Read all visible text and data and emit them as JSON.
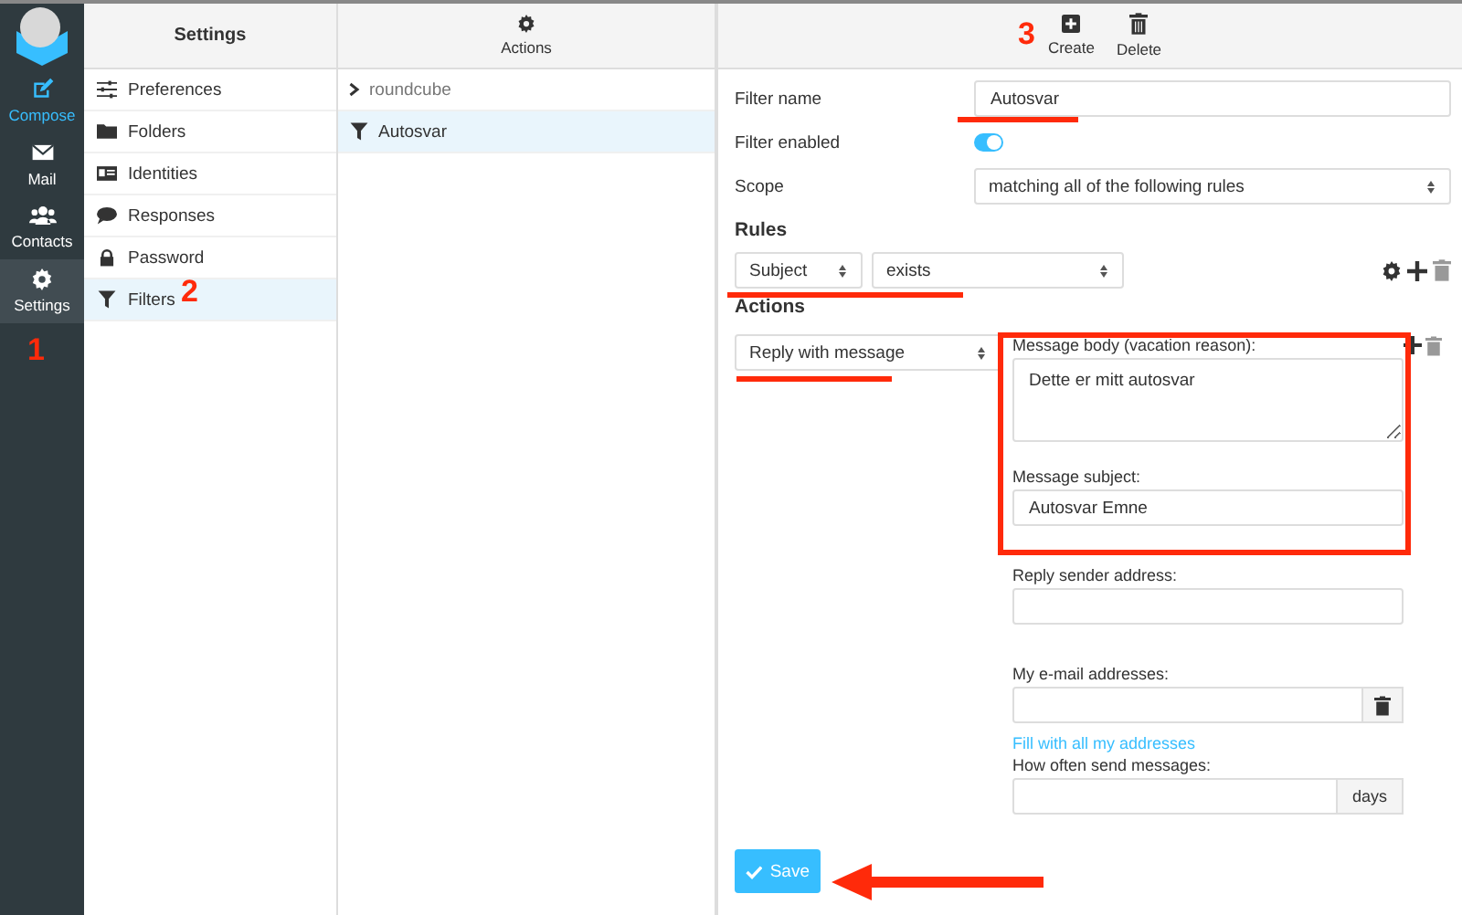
{
  "rail": [
    {
      "label": "Compose",
      "kind": "primary",
      "selected": false
    },
    {
      "label": "Mail",
      "kind": "nav",
      "selected": false
    },
    {
      "label": "Contacts",
      "kind": "nav",
      "selected": false
    },
    {
      "label": "Settings",
      "kind": "nav",
      "selected": true
    }
  ],
  "settings_panel": {
    "title": "Settings",
    "items": [
      {
        "label": "Preferences",
        "selected": false
      },
      {
        "label": "Folders",
        "selected": false
      },
      {
        "label": "Identities",
        "selected": false
      },
      {
        "label": "Responses",
        "selected": false
      },
      {
        "label": "Password",
        "selected": false
      },
      {
        "label": "Filters",
        "selected": true
      }
    ]
  },
  "filters_panel": {
    "toolbar_button": "Actions",
    "items": [
      {
        "kind": "set",
        "label": "roundcube",
        "selected": false
      },
      {
        "kind": "filter",
        "label": "Autosvar",
        "selected": true
      }
    ]
  },
  "content": {
    "toolbar": [
      "Create",
      "Delete"
    ],
    "filter_name": {
      "label": "Filter name",
      "value": "Autosvar"
    },
    "filter_enabled": {
      "label": "Filter enabled",
      "on": true
    },
    "scope": {
      "label": "Scope",
      "value": "matching all of the following rules"
    },
    "rules_heading": "Rules",
    "rule": {
      "header": "Subject",
      "operator": "exists"
    },
    "actions_heading": "Actions",
    "action": {
      "type": "Reply with message",
      "body": {
        "label": "Message body (vacation reason):",
        "value": "Dette er mitt autosvar"
      },
      "subject": {
        "label": "Message subject:",
        "value": "Autosvar Emne"
      },
      "sender": {
        "label": "Reply sender address:"
      },
      "addresses": {
        "label": "My e-mail addresses:",
        "link": "Fill with all my addresses"
      },
      "interval": {
        "label": "How often send messages:",
        "unit": "days"
      }
    },
    "save_button": "Save"
  },
  "annotations": [
    "1",
    "2",
    "3"
  ]
}
